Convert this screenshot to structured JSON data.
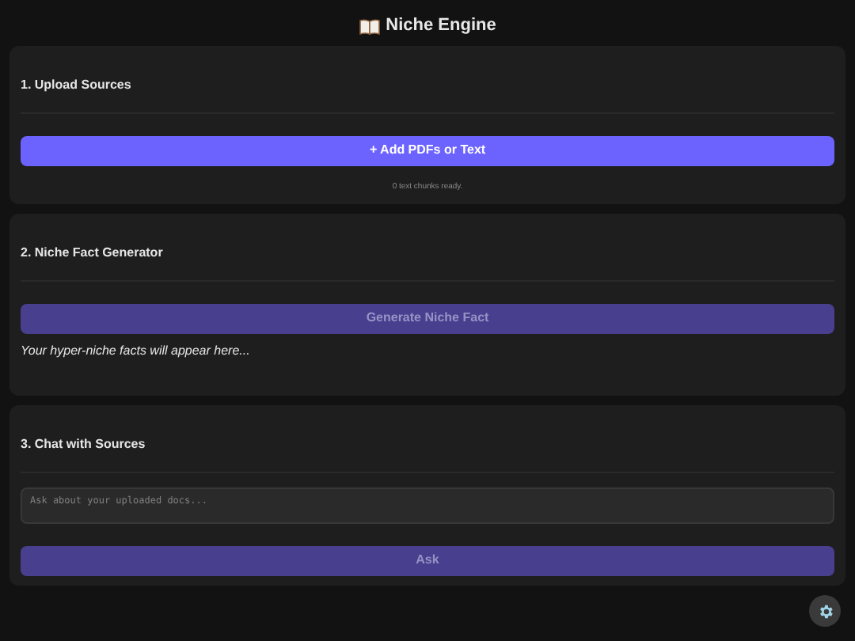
{
  "title": "Niche Engine",
  "upload": {
    "heading": "1. Upload Sources",
    "button": {
      "label": "+ Add PDFs or Text",
      "disabled": false
    },
    "status": "0 text chunks ready."
  },
  "generator": {
    "heading": "2. Niche Fact Generator",
    "button": {
      "label": "Generate Niche Fact",
      "disabled": true
    },
    "output": "Your hyper-niche facts will appear here..."
  },
  "chat": {
    "heading": "3. Chat with Sources",
    "input": {
      "placeholder": "Ask about your uploaded docs..."
    },
    "button": {
      "label": "Ask",
      "disabled": true
    }
  }
}
